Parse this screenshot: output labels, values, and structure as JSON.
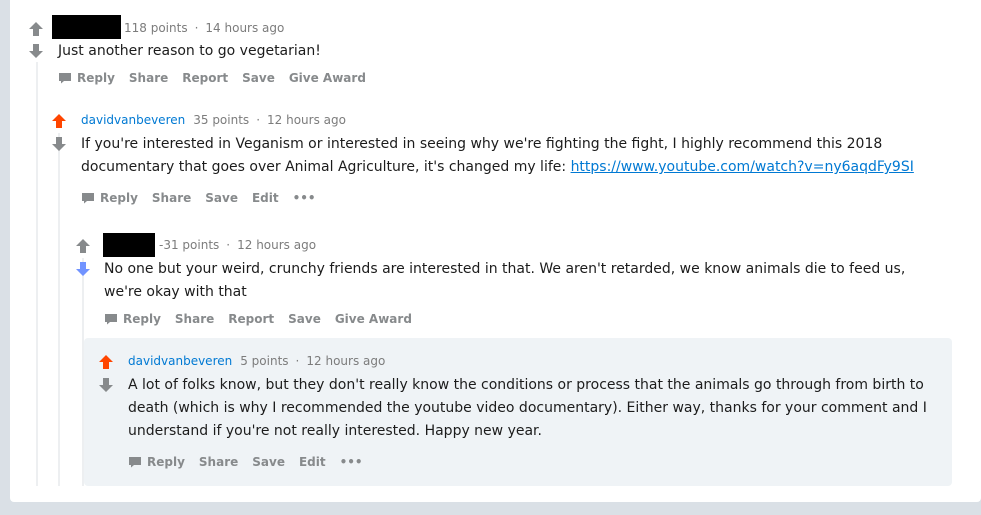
{
  "comments": [
    {
      "points": "118 points",
      "time": "14 hours ago",
      "body": "Just another reason to go vegetarian!",
      "actions": [
        "Reply",
        "Share",
        "Report",
        "Save",
        "Give Award"
      ]
    },
    {
      "author": "davidvanbeveren",
      "points": "35 points",
      "time": "12 hours ago",
      "body_line1": "If you're interested in Veganism or interested in seeing why we're fighting the fight, I highly recommend this 2018",
      "body_line2": "documentary that goes over Animal Agriculture, it's changed my life: ",
      "link": "https://www.youtube.com/watch?v=ny6aqdFy9SI",
      "actions": [
        "Reply",
        "Share",
        "Save",
        "Edit",
        "•••"
      ]
    },
    {
      "points": "-31 points",
      "time": "12 hours ago",
      "body_line1": "No one but your weird, crunchy friends are interested in that. We aren't retarded, we know animals die to feed us,",
      "body_line2": "we're okay with that",
      "actions": [
        "Reply",
        "Share",
        "Report",
        "Save",
        "Give Award"
      ]
    },
    {
      "author": "davidvanbeveren",
      "points": "5 points",
      "time": "12 hours ago",
      "body_line1": "A lot of folks know, but they don't really know the conditions or process that the animals go through from birth to",
      "body_line2": "death (which is why I recommended the youtube video documentary). Either way, thanks for your comment and I",
      "body_line3": "understand if you're not really interested. Happy new year.",
      "actions": [
        "Reply",
        "Share",
        "Save",
        "Edit",
        "•••"
      ]
    }
  ],
  "colors": {
    "upvote_active": "#ff4500",
    "downvote_active": "#7193ff",
    "vote_inactive": "#878a8c",
    "link": "#0079d3"
  }
}
